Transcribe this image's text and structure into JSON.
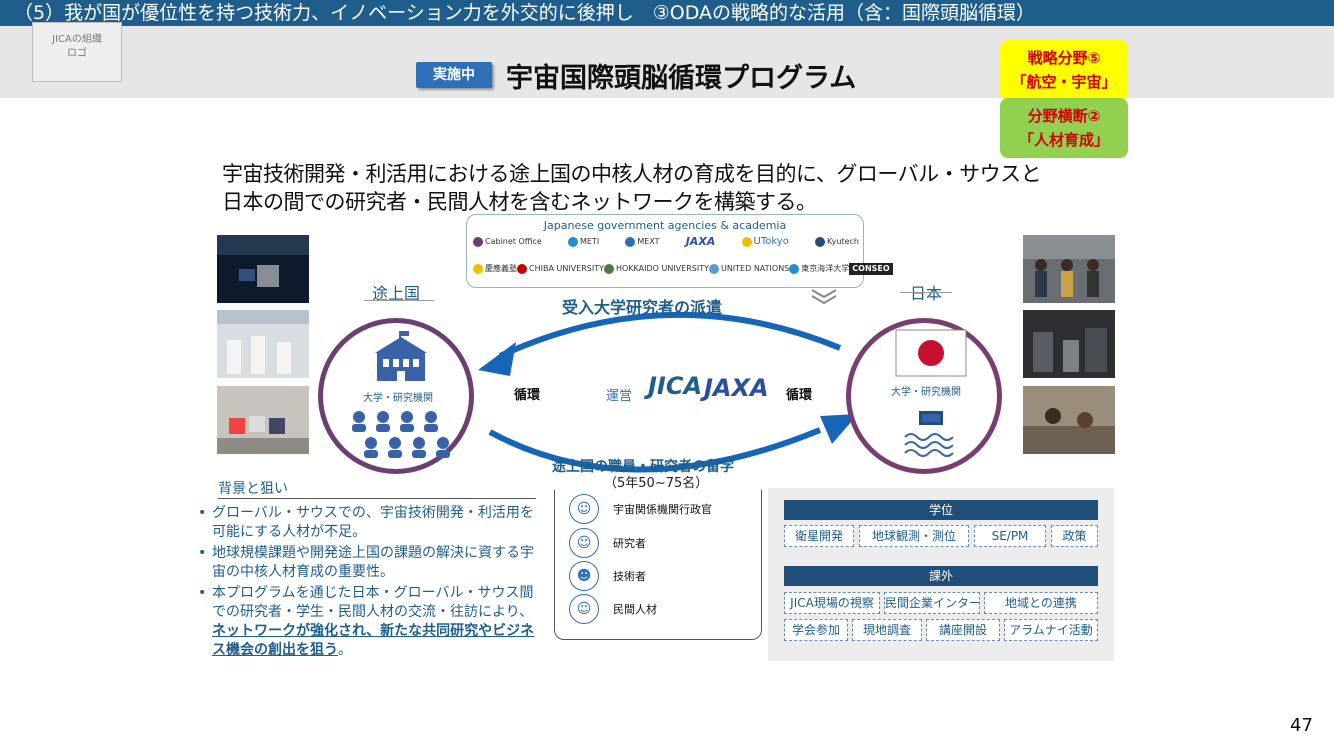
{
  "header": {
    "breadcrumb": "（5）我が国が優位性を持つ技術力、イノベーション力を外交的に後押し　③ODAの戦略的な活用（含：国際頭脳循環）",
    "logo_placeholder": "JICAの組織\nロゴ",
    "status": "実施中",
    "title": "宇宙国際頭脳循環プログラム"
  },
  "tags": [
    {
      "line1": "戦略分野⑤",
      "line2": "「航空・宇宙」",
      "color": "#ffff00"
    },
    {
      "line1": "分野横断②",
      "line2": "「人材育成」",
      "color": "#92d050"
    }
  ],
  "lead": {
    "line1": "宇宙技術開発・利活用における途上国の中核人材の育成を目的に、グローバル・サウスと",
    "line2": "日本の間での研究者・民間人材を含むネットワークを構築する。"
  },
  "agencies": {
    "title": "Japanese government agencies & academia",
    "row1": [
      "Cabinet Office",
      "METI",
      "MEXT",
      "JAXA",
      "UTokyo",
      "Kyutech"
    ],
    "row2": [
      "慶應義塾",
      "CHIBA UNIVERSITY",
      "HOKKAIDO UNIVERSITY",
      "UNITED NATIONS",
      "東京海洋大学",
      "CONSEO"
    ]
  },
  "diagram": {
    "left_label": "途上国",
    "right_label": "日本",
    "top_flow": "受入大学研究者の派遣",
    "bottom_flow": "途上国の職員・研究者の留学",
    "bottom_flow_sub": "（5年50~75名）",
    "circulation_left": "循環",
    "circulation_right": "循環",
    "operate": "運営",
    "jica": "JICA",
    "jaxa": "JAXA",
    "left_circle_text": "大学・研究機関",
    "right_circle_text": "大学・研究機関"
  },
  "background": {
    "heading": "背景と狙い",
    "bullets": [
      "グローバル・サウスでの、宇宙技術開発・利活用を可能にする人材が不足。",
      "地球規模課題や開発途上国の課題の解決に資する宇宙の中核人材育成の重要性。"
    ],
    "bullet3_plain": "本プログラムを通じた日本・グローバル・サウス間での研究者・学生・民間人材の交流・往訪により、",
    "bullet3_emphasis": "ネットワークが強化され、新たな共同研究やビジネス機会の創出を狙う",
    "bullet3_end": "。"
  },
  "roles": [
    "宇宙関係機関行政官",
    "研究者",
    "技術者",
    "民間人材"
  ],
  "programs": {
    "degree_heading": "学位",
    "degree_items": [
      "衛星開発",
      "地球観測・測位",
      "SE/PM",
      "政策"
    ],
    "extra_heading": "課外",
    "extra_items_row1": [
      "JICA現場の視察",
      "民間企業インターン",
      "地域との連携"
    ],
    "extra_items_row2": [
      "学会参加",
      "現地調査",
      "講座開設",
      "アラムナイ活動"
    ]
  },
  "page_number": "47"
}
